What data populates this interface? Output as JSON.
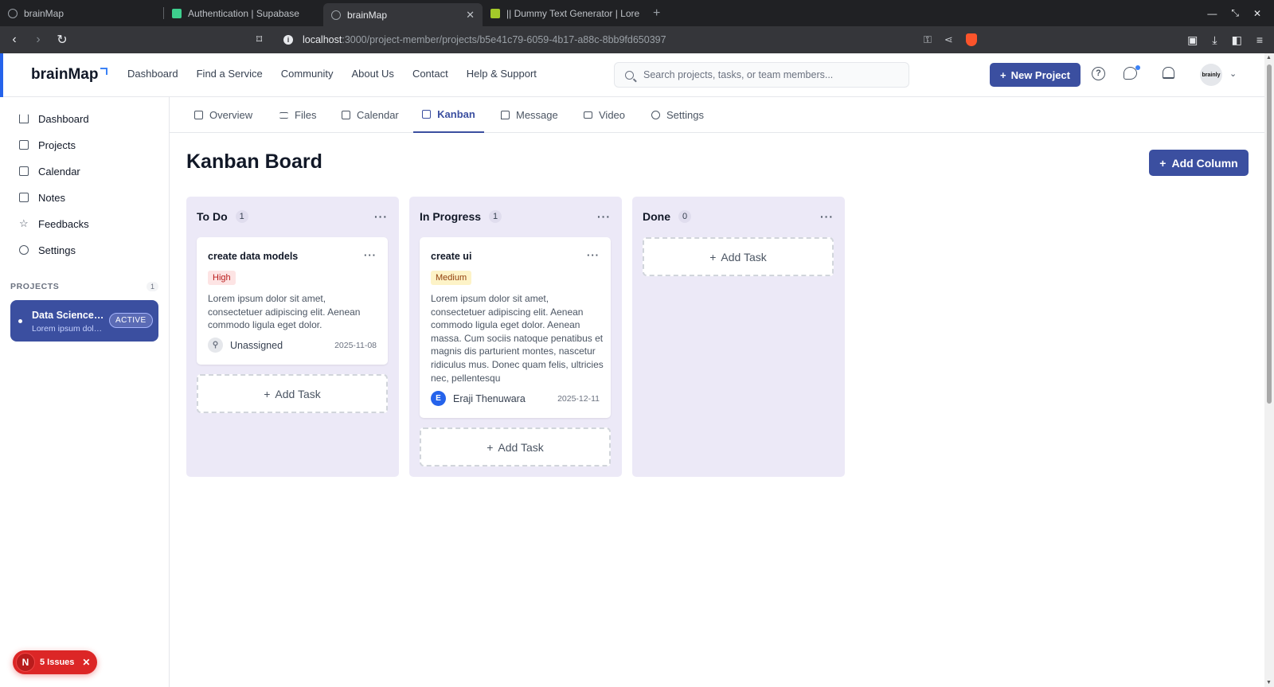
{
  "browser": {
    "tabs": [
      {
        "title": "brainMap",
        "active": false
      },
      {
        "title": "Authentication | Supabase",
        "active": false
      },
      {
        "title": "brainMap",
        "active": true
      },
      {
        "title": "|| Dummy Text Generator | Lore",
        "active": false
      }
    ],
    "new_tab": "+",
    "url_host": "localhost",
    "url_path": ":3000/project-member/projects/b5e41c79-6059-4b17-a88c-8bb9fd650397"
  },
  "app": {
    "logo": "brainMap",
    "nav": [
      "Dashboard",
      "Find a Service",
      "Community",
      "About Us",
      "Contact",
      "Help & Support"
    ],
    "search_placeholder": "Search projects, tasks, or team members...",
    "new_project": "New Project",
    "avatar_text": "brainly"
  },
  "sidebar": {
    "items": [
      {
        "label": "Dashboard",
        "icon": "home-icon"
      },
      {
        "label": "Projects",
        "icon": "file-icon"
      },
      {
        "label": "Calendar",
        "icon": "calendar-icon"
      },
      {
        "label": "Notes",
        "icon": "notes-icon"
      },
      {
        "label": "Feedbacks",
        "icon": "star-icon"
      },
      {
        "label": "Settings",
        "icon": "gear-icon"
      }
    ],
    "projects_heading": "PROJECTS",
    "projects_count": "1",
    "project": {
      "name": "Data Science Project",
      "description": "Lorem ipsum dolor sit amet",
      "status": "ACTIVE"
    }
  },
  "subtabs": [
    {
      "label": "Overview",
      "icon": "edit-icon"
    },
    {
      "label": "Files",
      "icon": "list-icon"
    },
    {
      "label": "Calendar",
      "icon": "calendar-icon"
    },
    {
      "label": "Kanban",
      "icon": "kanban-icon",
      "active": true
    },
    {
      "label": "Message",
      "icon": "message-icon"
    },
    {
      "label": "Video",
      "icon": "video-icon"
    },
    {
      "label": "Settings",
      "icon": "gear-icon"
    }
  ],
  "board": {
    "title": "Kanban Board",
    "add_column": "Add Column",
    "add_task": "Add Task",
    "columns": [
      {
        "title": "To Do",
        "count": "1",
        "cards": [
          {
            "title": "create data models",
            "priority": "High",
            "description": "Lorem ipsum dolor sit amet, consectetuer adipiscing elit. Aenean commodo ligula eget dolor.",
            "assignee": "Unassigned",
            "assignee_initial": "",
            "due": "2025-11-08"
          }
        ]
      },
      {
        "title": "In Progress",
        "count": "1",
        "cards": [
          {
            "title": "create ui",
            "priority": "Medium",
            "description": "Lorem ipsum dolor sit amet, consectetuer adipiscing elit. Aenean commodo ligula eget dolor. Aenean massa. Cum sociis natoque penatibus et magnis dis parturient montes, nascetur ridiculus mus. Donec quam felis, ultricies nec, pellentesqu",
            "assignee": "Eraji Thenuwara",
            "assignee_initial": "E",
            "due": "2025-12-11"
          }
        ]
      },
      {
        "title": "Done",
        "count": "0",
        "cards": []
      }
    ]
  },
  "issues": {
    "initial": "N",
    "label": "5 Issues"
  },
  "colors": {
    "primary": "#3b4fa0",
    "column_bg": "#ece9f7",
    "high": "#b91c1c",
    "medium": "#92400e"
  }
}
